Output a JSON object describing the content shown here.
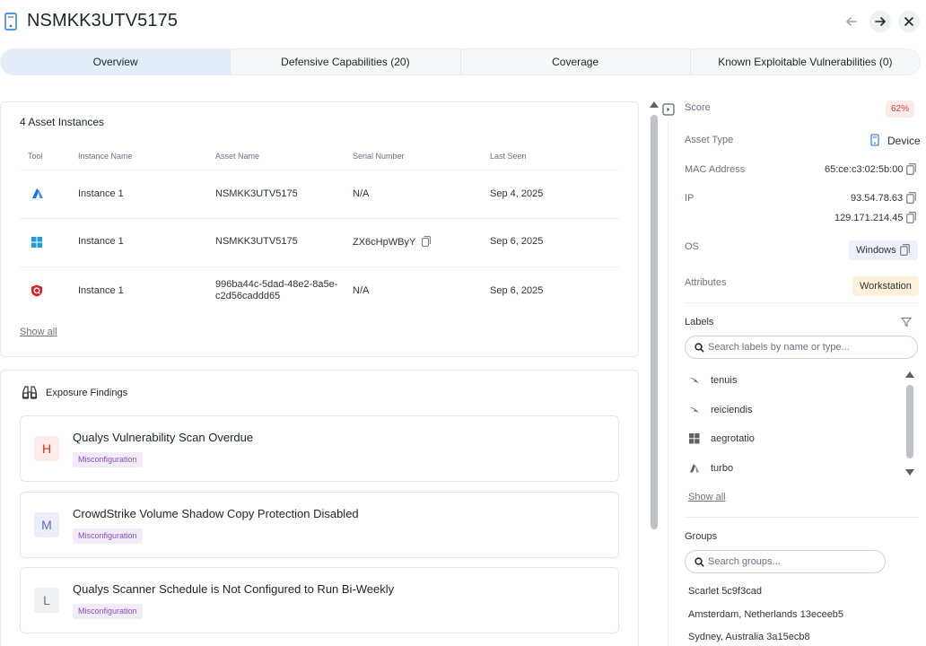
{
  "header": {
    "title": "NSMKK3UTV5175",
    "icons": {
      "asset": "device-icon",
      "back": "arrow-left-icon",
      "forward": "arrow-right-icon",
      "close": "close-icon"
    }
  },
  "tabs": [
    {
      "label": "Overview",
      "active": true
    },
    {
      "label": "Defensive Capabilities (20)",
      "active": false
    },
    {
      "label": "Coverage",
      "active": false
    },
    {
      "label": "Known Exploitable Vulnerabilities (0)",
      "active": false
    }
  ],
  "instances": {
    "title": "4 Asset Instances",
    "columns": [
      "Tool",
      "Instance Name",
      "Asset Name",
      "Serial Number",
      "Last Seen"
    ],
    "rows": [
      {
        "tool_icon": "azure-icon",
        "instance": "Instance 1",
        "asset": "NSMKK3UTV5175",
        "serial": "N/A",
        "last_seen": "Sep 4, 2025"
      },
      {
        "tool_icon": "windows-icon",
        "instance": "Instance 1",
        "asset": "NSMKK3UTV5175",
        "serial": "ZX6cHpWByY",
        "last_seen": "Sep 6, 2025"
      },
      {
        "tool_icon": "qualys-icon",
        "instance": "Instance 1",
        "asset_line1": "996ba44c-5dad-48e2-8a5e-",
        "asset_line2": "c2d56caddd65",
        "serial": "N/A",
        "last_seen": "Sep 6, 2025"
      }
    ],
    "show_all": "Show all"
  },
  "findings": {
    "title": "Exposure Findings",
    "items": [
      {
        "severity": "H",
        "title": "Qualys Vulnerability Scan Overdue",
        "tag": "Misconfiguration"
      },
      {
        "severity": "M",
        "title": "CrowdStrike Volume Shadow Copy Protection Disabled",
        "tag": "Misconfiguration"
      },
      {
        "severity": "L",
        "title": "Qualys Scanner Schedule is Not Configured to Run Bi-Weekly",
        "tag": "Misconfiguration"
      }
    ]
  },
  "details": {
    "score_label": "Score",
    "score_value": "62%",
    "asset_type_label": "Asset Type",
    "asset_type_value": "Device",
    "mac_label": "MAC Address",
    "mac_value": "65:ce:c3:02:5b:00",
    "ip_label": "IP",
    "ip_values": [
      "93.54.78.63",
      "129.171.214.45"
    ],
    "os_label": "OS",
    "os_value": "Windows",
    "attributes_label": "Attributes",
    "attributes_value": "Workstation"
  },
  "labels": {
    "title": "Labels",
    "search_placeholder": "Search labels by name or type...",
    "items": [
      {
        "icon": "crowdstrike-icon",
        "text": "tenuis"
      },
      {
        "icon": "crowdstrike-icon",
        "text": "reiciendis"
      },
      {
        "icon": "windows-icon",
        "text": "aegrotatio"
      },
      {
        "icon": "azure-icon",
        "text": "turbo"
      }
    ],
    "show_all": "Show all"
  },
  "groups": {
    "title": "Groups",
    "search_placeholder": "Search groups...",
    "items": [
      "Scarlet 5c9f3cad",
      "Amsterdam, Netherlands 13eceeb5",
      "Sydney, Australia 3a15ecb8"
    ]
  },
  "colors": {
    "accent_blue": "#1a73e8",
    "high": "#d93025",
    "medium": "#5c6bc0",
    "low": "#6b7280",
    "tag_purple": "#8a4dbf",
    "score_red": "#d0453a"
  }
}
